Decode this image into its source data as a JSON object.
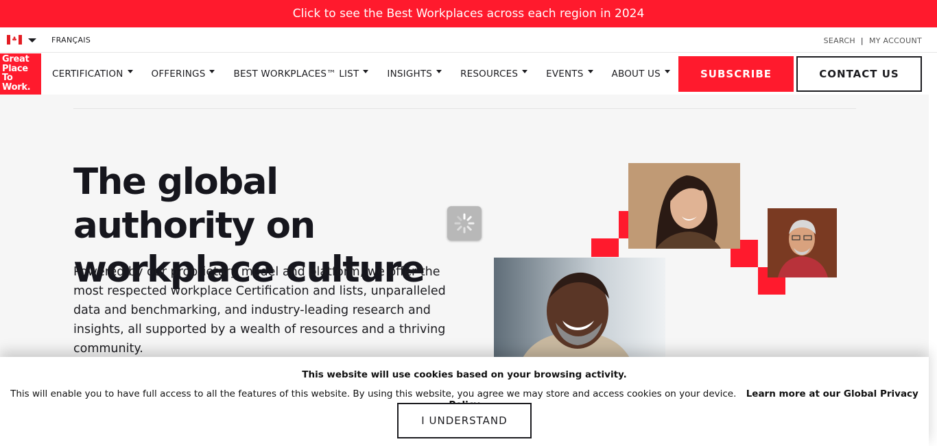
{
  "promo_banner": {
    "text": "Click to see the Best Workplaces across each region in 2024"
  },
  "utility_bar": {
    "language_link": "FRANÇAIS",
    "search_label": "SEARCH",
    "separator": "|",
    "account_label": "MY ACCOUNT",
    "flag_icon": "canada-flag-icon"
  },
  "logo": {
    "lines": [
      "Great",
      "Place",
      "To",
      "Work."
    ]
  },
  "nav": {
    "items": [
      {
        "label": "CERTIFICATION"
      },
      {
        "label": "OFFERINGS"
      },
      {
        "label": "BEST WORKPLACES™ LIST"
      },
      {
        "label": "INSIGHTS"
      },
      {
        "label": "RESOURCES"
      },
      {
        "label": "EVENTS"
      },
      {
        "label": "ABOUT US"
      }
    ],
    "subscribe_label": "SUBSCRIBE",
    "contact_label": "CONTACT US"
  },
  "hero": {
    "title": "The global authority on workplace culture",
    "body": "Powered by our proprietary model and platform, we offer the most respected workplace Certification and lists, unparalleled data and benchmarking, and industry-leading research and insights, all supported by a wealth of resources and a thriving community."
  },
  "cookie_banner": {
    "title": "This website will use cookies based on your browsing activity.",
    "body": "This will enable you to have full access to all the features of this website. By using this website, you agree we may store and access cookies on your device.",
    "policy_link": "Learn more at our Global Privacy Policy",
    "accept_label": "I UNDERSTAND"
  },
  "colors": {
    "brand_red": "#ff1a2d",
    "text_dark": "#16161d",
    "background": "#f6f6f6"
  }
}
